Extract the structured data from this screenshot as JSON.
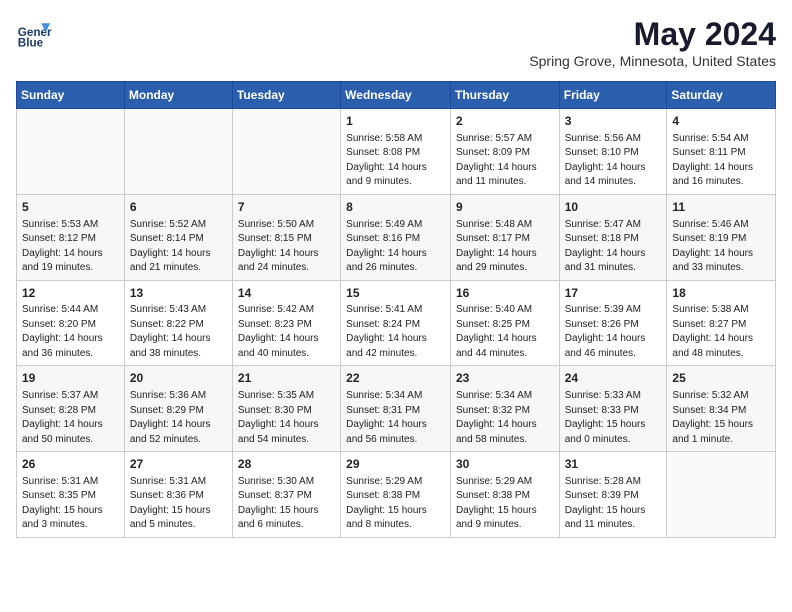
{
  "header": {
    "logo_line1": "General",
    "logo_line2": "Blue",
    "month": "May 2024",
    "location": "Spring Grove, Minnesota, United States"
  },
  "days_of_week": [
    "Sunday",
    "Monday",
    "Tuesday",
    "Wednesday",
    "Thursday",
    "Friday",
    "Saturday"
  ],
  "weeks": [
    [
      {
        "day": "",
        "text": ""
      },
      {
        "day": "",
        "text": ""
      },
      {
        "day": "",
        "text": ""
      },
      {
        "day": "1",
        "text": "Sunrise: 5:58 AM\nSunset: 8:08 PM\nDaylight: 14 hours\nand 9 minutes."
      },
      {
        "day": "2",
        "text": "Sunrise: 5:57 AM\nSunset: 8:09 PM\nDaylight: 14 hours\nand 11 minutes."
      },
      {
        "day": "3",
        "text": "Sunrise: 5:56 AM\nSunset: 8:10 PM\nDaylight: 14 hours\nand 14 minutes."
      },
      {
        "day": "4",
        "text": "Sunrise: 5:54 AM\nSunset: 8:11 PM\nDaylight: 14 hours\nand 16 minutes."
      }
    ],
    [
      {
        "day": "5",
        "text": "Sunrise: 5:53 AM\nSunset: 8:12 PM\nDaylight: 14 hours\nand 19 minutes."
      },
      {
        "day": "6",
        "text": "Sunrise: 5:52 AM\nSunset: 8:14 PM\nDaylight: 14 hours\nand 21 minutes."
      },
      {
        "day": "7",
        "text": "Sunrise: 5:50 AM\nSunset: 8:15 PM\nDaylight: 14 hours\nand 24 minutes."
      },
      {
        "day": "8",
        "text": "Sunrise: 5:49 AM\nSunset: 8:16 PM\nDaylight: 14 hours\nand 26 minutes."
      },
      {
        "day": "9",
        "text": "Sunrise: 5:48 AM\nSunset: 8:17 PM\nDaylight: 14 hours\nand 29 minutes."
      },
      {
        "day": "10",
        "text": "Sunrise: 5:47 AM\nSunset: 8:18 PM\nDaylight: 14 hours\nand 31 minutes."
      },
      {
        "day": "11",
        "text": "Sunrise: 5:46 AM\nSunset: 8:19 PM\nDaylight: 14 hours\nand 33 minutes."
      }
    ],
    [
      {
        "day": "12",
        "text": "Sunrise: 5:44 AM\nSunset: 8:20 PM\nDaylight: 14 hours\nand 36 minutes."
      },
      {
        "day": "13",
        "text": "Sunrise: 5:43 AM\nSunset: 8:22 PM\nDaylight: 14 hours\nand 38 minutes."
      },
      {
        "day": "14",
        "text": "Sunrise: 5:42 AM\nSunset: 8:23 PM\nDaylight: 14 hours\nand 40 minutes."
      },
      {
        "day": "15",
        "text": "Sunrise: 5:41 AM\nSunset: 8:24 PM\nDaylight: 14 hours\nand 42 minutes."
      },
      {
        "day": "16",
        "text": "Sunrise: 5:40 AM\nSunset: 8:25 PM\nDaylight: 14 hours\nand 44 minutes."
      },
      {
        "day": "17",
        "text": "Sunrise: 5:39 AM\nSunset: 8:26 PM\nDaylight: 14 hours\nand 46 minutes."
      },
      {
        "day": "18",
        "text": "Sunrise: 5:38 AM\nSunset: 8:27 PM\nDaylight: 14 hours\nand 48 minutes."
      }
    ],
    [
      {
        "day": "19",
        "text": "Sunrise: 5:37 AM\nSunset: 8:28 PM\nDaylight: 14 hours\nand 50 minutes."
      },
      {
        "day": "20",
        "text": "Sunrise: 5:36 AM\nSunset: 8:29 PM\nDaylight: 14 hours\nand 52 minutes."
      },
      {
        "day": "21",
        "text": "Sunrise: 5:35 AM\nSunset: 8:30 PM\nDaylight: 14 hours\nand 54 minutes."
      },
      {
        "day": "22",
        "text": "Sunrise: 5:34 AM\nSunset: 8:31 PM\nDaylight: 14 hours\nand 56 minutes."
      },
      {
        "day": "23",
        "text": "Sunrise: 5:34 AM\nSunset: 8:32 PM\nDaylight: 14 hours\nand 58 minutes."
      },
      {
        "day": "24",
        "text": "Sunrise: 5:33 AM\nSunset: 8:33 PM\nDaylight: 15 hours\nand 0 minutes."
      },
      {
        "day": "25",
        "text": "Sunrise: 5:32 AM\nSunset: 8:34 PM\nDaylight: 15 hours\nand 1 minute."
      }
    ],
    [
      {
        "day": "26",
        "text": "Sunrise: 5:31 AM\nSunset: 8:35 PM\nDaylight: 15 hours\nand 3 minutes."
      },
      {
        "day": "27",
        "text": "Sunrise: 5:31 AM\nSunset: 8:36 PM\nDaylight: 15 hours\nand 5 minutes."
      },
      {
        "day": "28",
        "text": "Sunrise: 5:30 AM\nSunset: 8:37 PM\nDaylight: 15 hours\nand 6 minutes."
      },
      {
        "day": "29",
        "text": "Sunrise: 5:29 AM\nSunset: 8:38 PM\nDaylight: 15 hours\nand 8 minutes."
      },
      {
        "day": "30",
        "text": "Sunrise: 5:29 AM\nSunset: 8:38 PM\nDaylight: 15 hours\nand 9 minutes."
      },
      {
        "day": "31",
        "text": "Sunrise: 5:28 AM\nSunset: 8:39 PM\nDaylight: 15 hours\nand 11 minutes."
      },
      {
        "day": "",
        "text": ""
      }
    ]
  ]
}
